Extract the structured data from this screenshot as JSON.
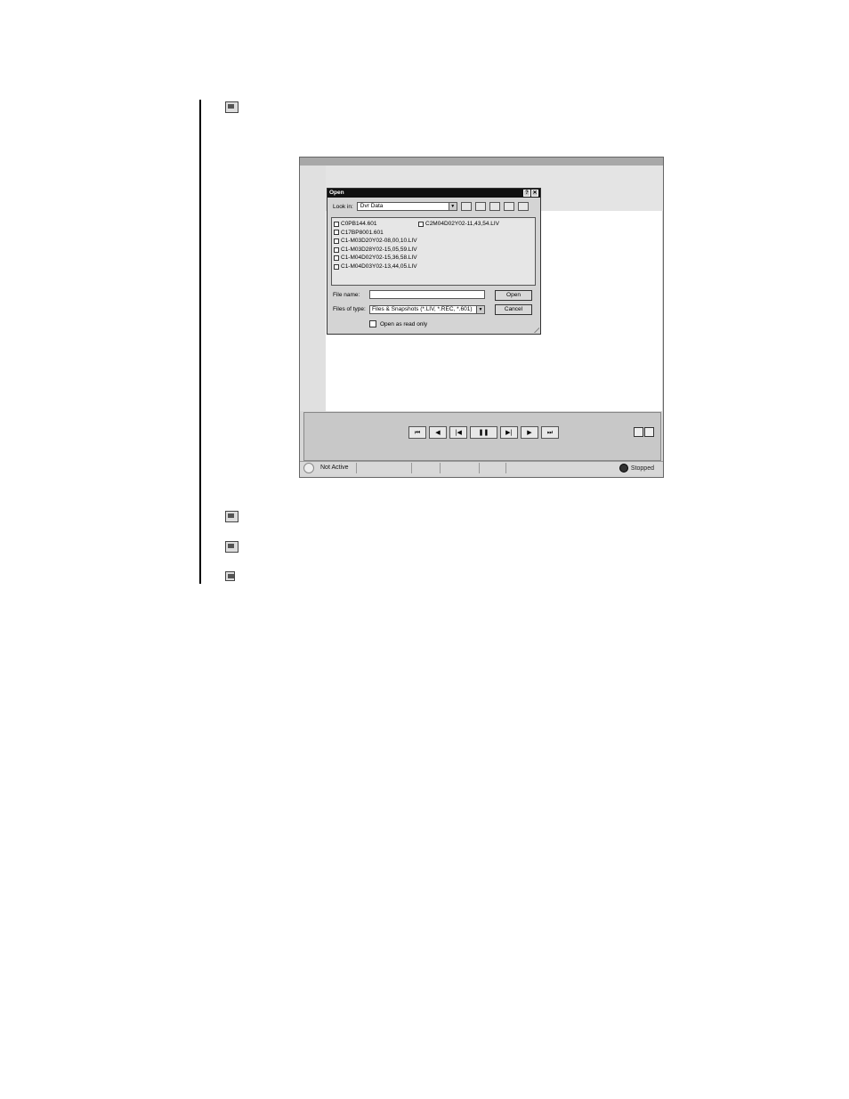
{
  "dialog": {
    "title": "Open",
    "help_btn": "?",
    "close_btn": "✕",
    "look_in_label": "Look in:",
    "look_in_value": "Dvr Data",
    "files_col1": [
      "C0PB144.601",
      "C17BP8001.601",
      "C1-M03D20Y02-08,00,10.LIV",
      "C1-M03D28Y02-15,05,59.LIV",
      "C1-M04D02Y02-15,36,58.LIV",
      "C1-M04D03Y02-13,44,05.LIV"
    ],
    "files_col2": [
      "C2M04D02Y02-11,43,54.LIV"
    ],
    "file_name_label": "File name:",
    "file_name_value": "",
    "files_type_label": "Files of type:",
    "files_type_value": "Files & Snapshots (*.LIV, *.REC, *.601)",
    "open_btn": "Open",
    "cancel_btn": "Cancel",
    "read_only_label": "Open as read only"
  },
  "transport": {
    "buttons": [
      "⏮",
      "◀",
      "|◀",
      "❚❚",
      "▶|",
      "▶",
      "⏭"
    ]
  },
  "statusbar": {
    "connection": "Not Active",
    "state": "Stopped"
  }
}
